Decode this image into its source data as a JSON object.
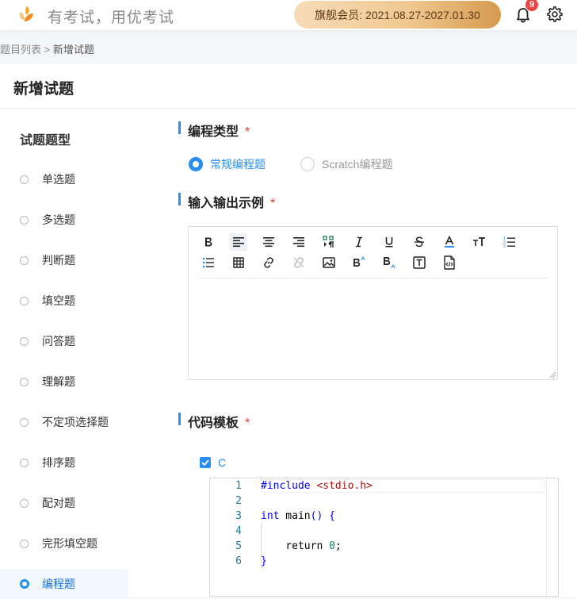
{
  "header": {
    "slogan": "有考试，用优考试",
    "member_label": "旗舰会员:",
    "member_period": "2021.08.27-2027.01.30",
    "notification_count": "9"
  },
  "breadcrumb": {
    "parent": "题目列表",
    "separator": ">",
    "current": "新增试题"
  },
  "page_title": "新增试题",
  "sidebar": {
    "title": "试题题型",
    "items": [
      {
        "label": "单选题",
        "active": false
      },
      {
        "label": "多选题",
        "active": false
      },
      {
        "label": "判断题",
        "active": false
      },
      {
        "label": "填空题",
        "active": false
      },
      {
        "label": "问答题",
        "active": false
      },
      {
        "label": "理解题",
        "active": false
      },
      {
        "label": "不定项选择题",
        "active": false
      },
      {
        "label": "排序题",
        "active": false
      },
      {
        "label": "配对题",
        "active": false
      },
      {
        "label": "完形填空题",
        "active": false
      },
      {
        "label": "编程题",
        "active": true
      }
    ]
  },
  "programming_type": {
    "title": "编程类型",
    "required_mark": "*",
    "options": [
      {
        "label": "常规编程题",
        "selected": true
      },
      {
        "label": "Scratch编程题",
        "selected": false
      }
    ]
  },
  "io_example": {
    "title": "输入输出示例",
    "required_mark": "*",
    "toolbar": [
      "bold-icon",
      "align-left-icon",
      "align-center-icon",
      "align-right-icon",
      "paragraph-mark-icon",
      "italic-icon",
      "underline-icon",
      "strikethrough-icon",
      "font-color-icon",
      "font-size-icon",
      "ordered-list-icon",
      "unordered-list-icon",
      "table-icon",
      "link-icon",
      "unlink-icon",
      "image-icon",
      "superscript-icon",
      "subscript-icon",
      "text-box-icon",
      "code-file-icon"
    ]
  },
  "code_template": {
    "title": "代码模板",
    "required_mark": "*",
    "language_label": "C",
    "language_checked": true,
    "line_numbers": [
      "1",
      "2",
      "3",
      "4",
      "5",
      "6"
    ],
    "lines": [
      "#include <stdio.h>",
      "",
      "int main() {",
      "",
      "    return 0;",
      "}"
    ]
  },
  "colors": {
    "accent": "#2a8df0",
    "required": "#e53935",
    "member_gradient_start": "#f7dcb8",
    "member_gradient_end": "#d69a4e",
    "badge": "#ef4444"
  }
}
